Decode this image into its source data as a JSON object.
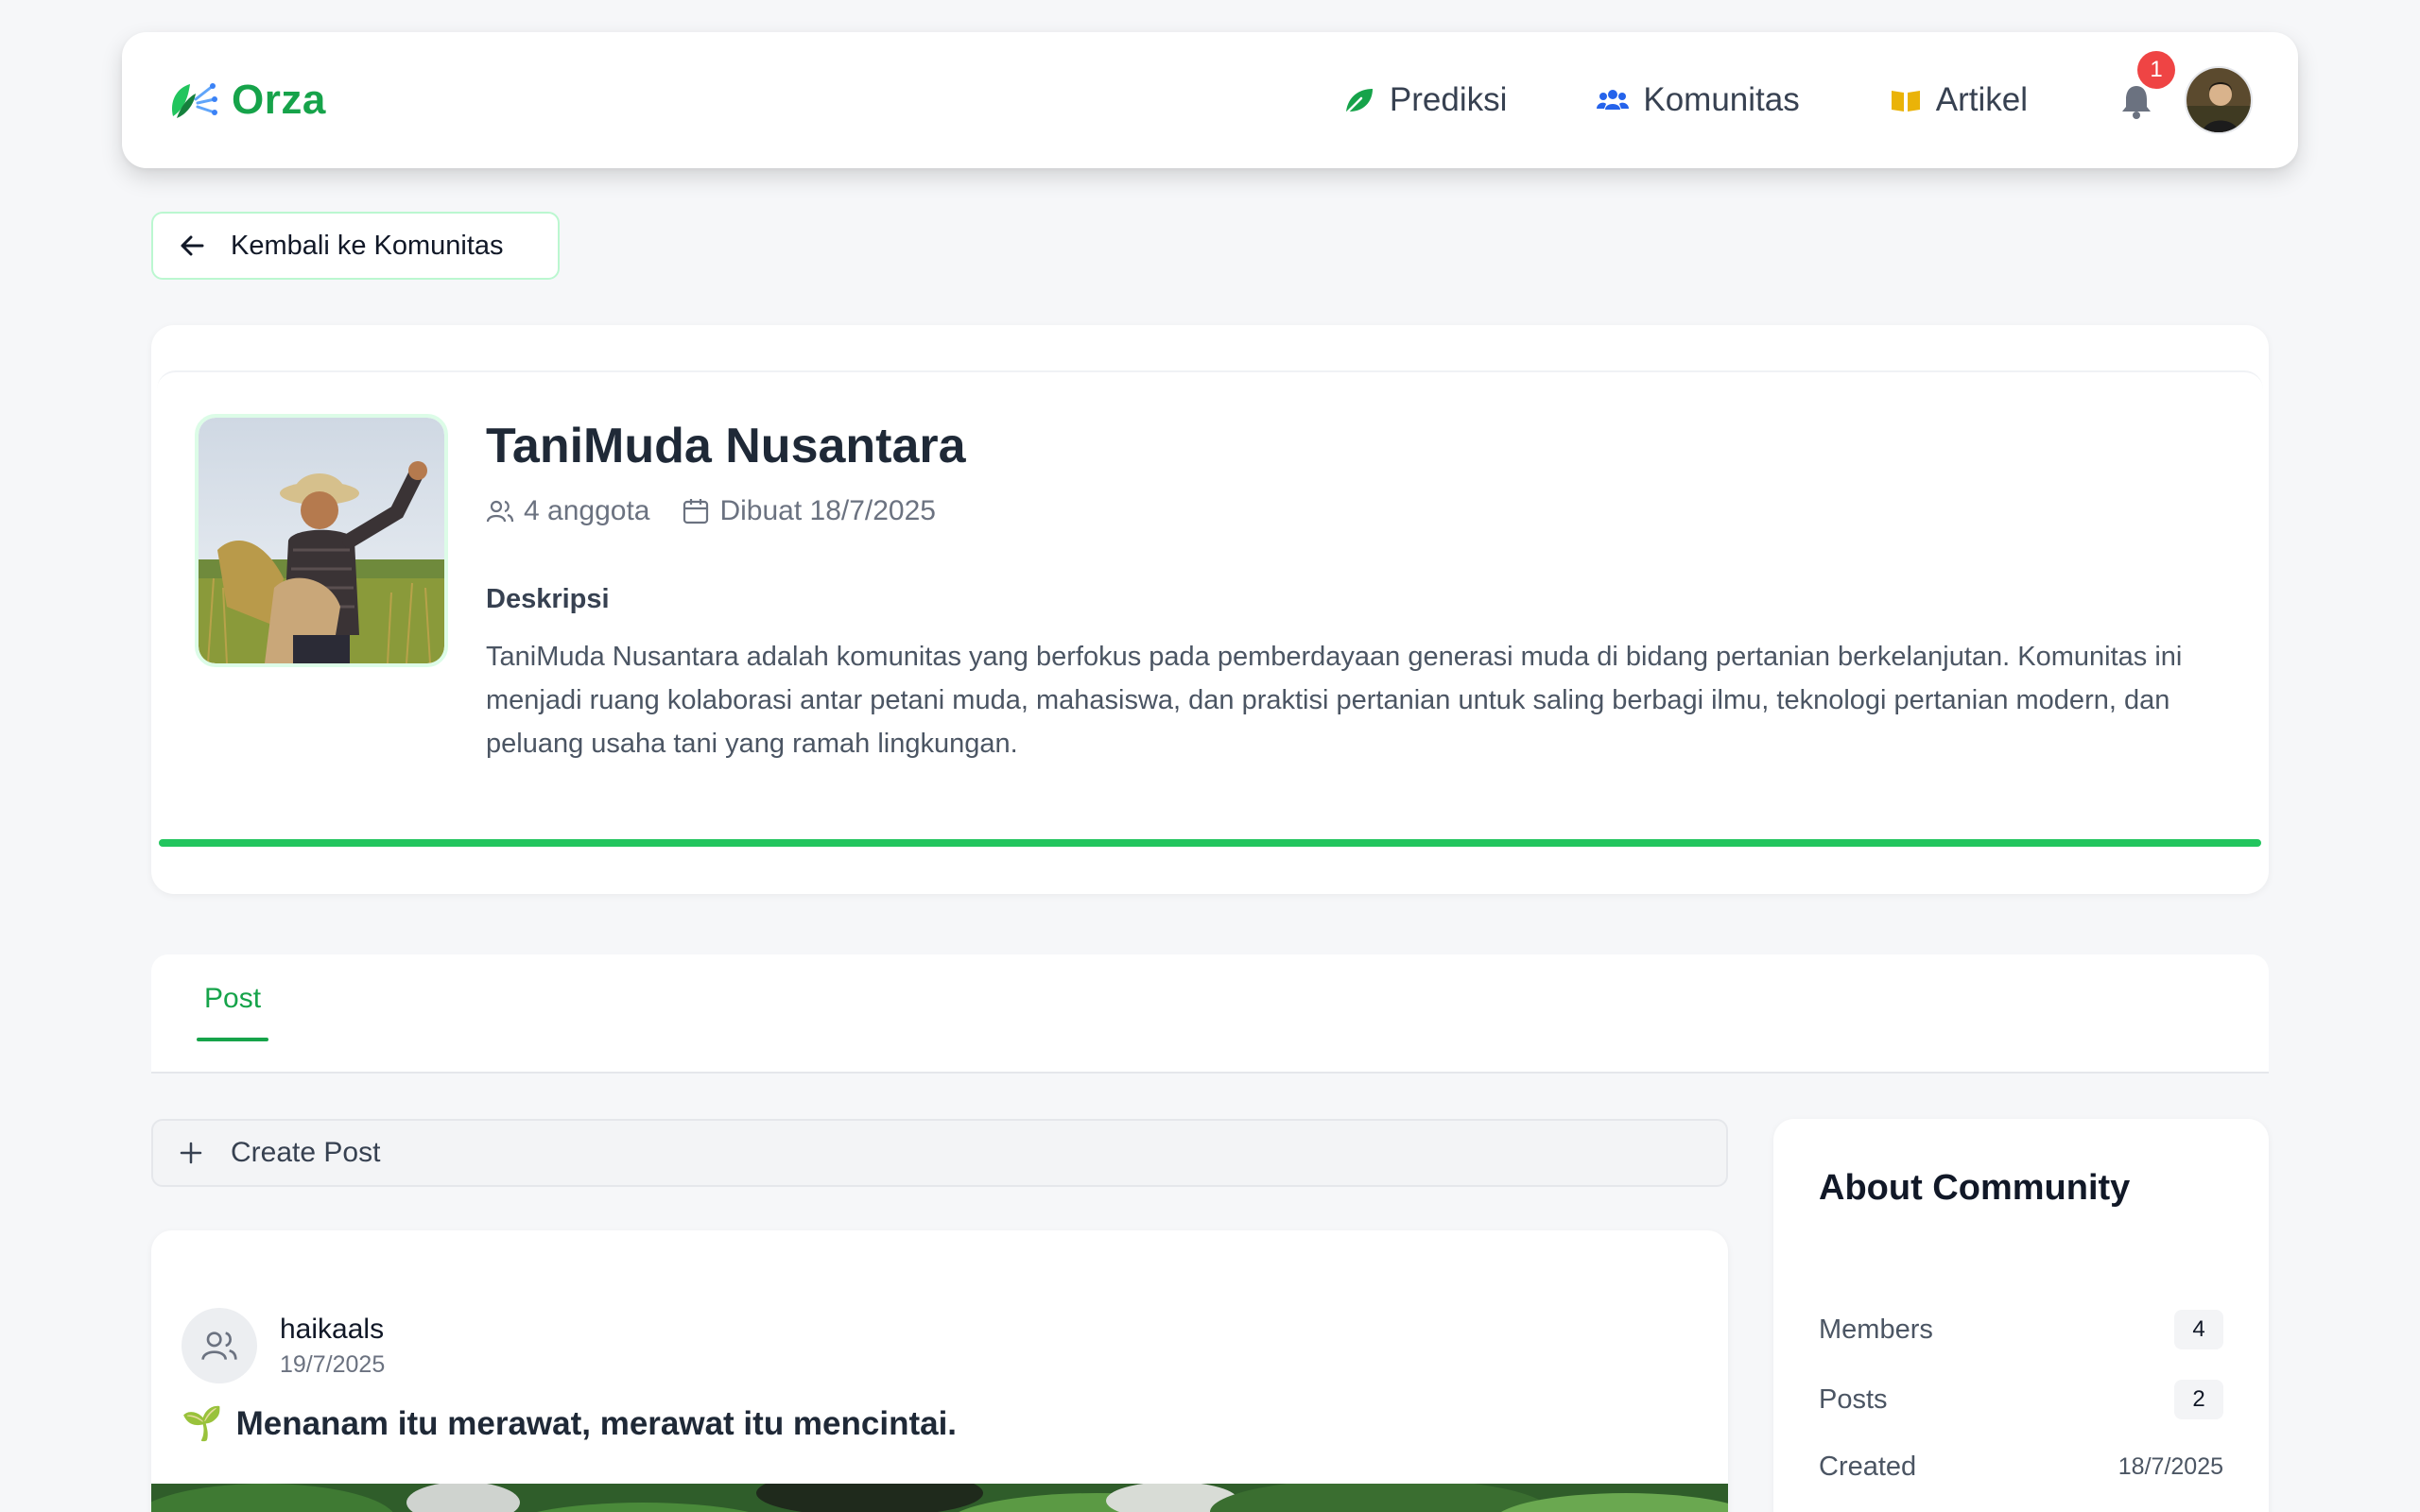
{
  "nav": {
    "brand": "Orza",
    "links": [
      {
        "label": "Prediksi",
        "icon": "leaf-icon",
        "color": "#16a34a"
      },
      {
        "label": "Komunitas",
        "icon": "users-icon",
        "color": "#2563eb"
      },
      {
        "label": "Artikel",
        "icon": "book-icon",
        "color": "#eab308"
      }
    ],
    "notification_count": "1"
  },
  "back_button": {
    "label": "Kembali ke Komunitas"
  },
  "community": {
    "name": "TaniMuda Nusantara",
    "members_text": "4 anggota",
    "created_text": "Dibuat 18/7/2025",
    "description_label": "Deskripsi",
    "description": "TaniMuda Nusantara adalah komunitas yang berfokus pada pemberdayaan generasi muda di bidang pertanian berkelanjutan. Komunitas ini menjadi ruang kolaborasi antar petani muda, mahasiswa, dan praktisi pertanian untuk saling berbagi ilmu, teknologi pertanian modern, dan peluang usaha tani yang ramah lingkungan."
  },
  "tabs": [
    {
      "label": "Post",
      "active": true
    }
  ],
  "create_post": {
    "label": "Create Post"
  },
  "post": {
    "author": "haikaals",
    "date": "19/7/2025",
    "emoji": "🌱",
    "title": "Menanam itu merawat, merawat itu mencintai."
  },
  "about": {
    "title": "About Community",
    "stats": [
      {
        "label": "Members",
        "value": "4"
      },
      {
        "label": "Posts",
        "value": "2"
      },
      {
        "label": "Created",
        "value": "18/7/2025"
      }
    ]
  },
  "colors": {
    "accent": "#16a34a",
    "bar": "#22c55e",
    "badge": "#ef4444"
  }
}
